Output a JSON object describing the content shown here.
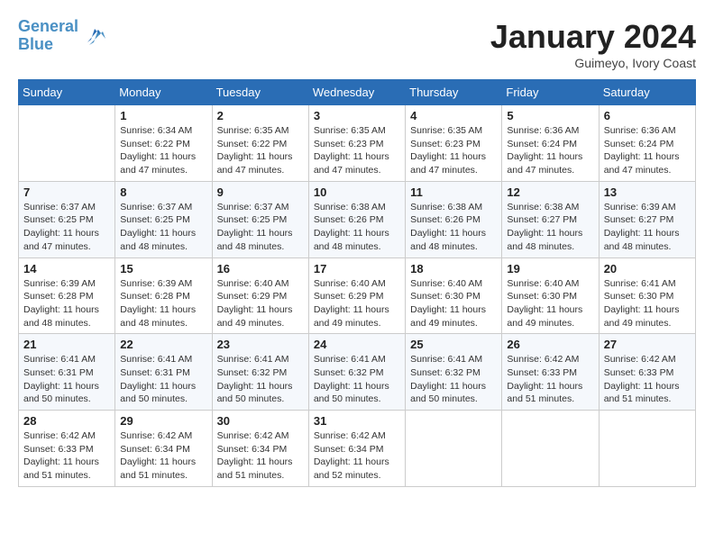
{
  "header": {
    "logo_line1": "General",
    "logo_line2": "Blue",
    "month": "January 2024",
    "location": "Guimeyo, Ivory Coast"
  },
  "days_of_week": [
    "Sunday",
    "Monday",
    "Tuesday",
    "Wednesday",
    "Thursday",
    "Friday",
    "Saturday"
  ],
  "weeks": [
    [
      {
        "day": "",
        "info": ""
      },
      {
        "day": "1",
        "info": "Sunrise: 6:34 AM\nSunset: 6:22 PM\nDaylight: 11 hours\nand 47 minutes."
      },
      {
        "day": "2",
        "info": "Sunrise: 6:35 AM\nSunset: 6:22 PM\nDaylight: 11 hours\nand 47 minutes."
      },
      {
        "day": "3",
        "info": "Sunrise: 6:35 AM\nSunset: 6:23 PM\nDaylight: 11 hours\nand 47 minutes."
      },
      {
        "day": "4",
        "info": "Sunrise: 6:35 AM\nSunset: 6:23 PM\nDaylight: 11 hours\nand 47 minutes."
      },
      {
        "day": "5",
        "info": "Sunrise: 6:36 AM\nSunset: 6:24 PM\nDaylight: 11 hours\nand 47 minutes."
      },
      {
        "day": "6",
        "info": "Sunrise: 6:36 AM\nSunset: 6:24 PM\nDaylight: 11 hours\nand 47 minutes."
      }
    ],
    [
      {
        "day": "7",
        "info": "Sunrise: 6:37 AM\nSunset: 6:25 PM\nDaylight: 11 hours\nand 47 minutes."
      },
      {
        "day": "8",
        "info": "Sunrise: 6:37 AM\nSunset: 6:25 PM\nDaylight: 11 hours\nand 48 minutes."
      },
      {
        "day": "9",
        "info": "Sunrise: 6:37 AM\nSunset: 6:25 PM\nDaylight: 11 hours\nand 48 minutes."
      },
      {
        "day": "10",
        "info": "Sunrise: 6:38 AM\nSunset: 6:26 PM\nDaylight: 11 hours\nand 48 minutes."
      },
      {
        "day": "11",
        "info": "Sunrise: 6:38 AM\nSunset: 6:26 PM\nDaylight: 11 hours\nand 48 minutes."
      },
      {
        "day": "12",
        "info": "Sunrise: 6:38 AM\nSunset: 6:27 PM\nDaylight: 11 hours\nand 48 minutes."
      },
      {
        "day": "13",
        "info": "Sunrise: 6:39 AM\nSunset: 6:27 PM\nDaylight: 11 hours\nand 48 minutes."
      }
    ],
    [
      {
        "day": "14",
        "info": "Sunrise: 6:39 AM\nSunset: 6:28 PM\nDaylight: 11 hours\nand 48 minutes."
      },
      {
        "day": "15",
        "info": "Sunrise: 6:39 AM\nSunset: 6:28 PM\nDaylight: 11 hours\nand 48 minutes."
      },
      {
        "day": "16",
        "info": "Sunrise: 6:40 AM\nSunset: 6:29 PM\nDaylight: 11 hours\nand 49 minutes."
      },
      {
        "day": "17",
        "info": "Sunrise: 6:40 AM\nSunset: 6:29 PM\nDaylight: 11 hours\nand 49 minutes."
      },
      {
        "day": "18",
        "info": "Sunrise: 6:40 AM\nSunset: 6:30 PM\nDaylight: 11 hours\nand 49 minutes."
      },
      {
        "day": "19",
        "info": "Sunrise: 6:40 AM\nSunset: 6:30 PM\nDaylight: 11 hours\nand 49 minutes."
      },
      {
        "day": "20",
        "info": "Sunrise: 6:41 AM\nSunset: 6:30 PM\nDaylight: 11 hours\nand 49 minutes."
      }
    ],
    [
      {
        "day": "21",
        "info": "Sunrise: 6:41 AM\nSunset: 6:31 PM\nDaylight: 11 hours\nand 50 minutes."
      },
      {
        "day": "22",
        "info": "Sunrise: 6:41 AM\nSunset: 6:31 PM\nDaylight: 11 hours\nand 50 minutes."
      },
      {
        "day": "23",
        "info": "Sunrise: 6:41 AM\nSunset: 6:32 PM\nDaylight: 11 hours\nand 50 minutes."
      },
      {
        "day": "24",
        "info": "Sunrise: 6:41 AM\nSunset: 6:32 PM\nDaylight: 11 hours\nand 50 minutes."
      },
      {
        "day": "25",
        "info": "Sunrise: 6:41 AM\nSunset: 6:32 PM\nDaylight: 11 hours\nand 50 minutes."
      },
      {
        "day": "26",
        "info": "Sunrise: 6:42 AM\nSunset: 6:33 PM\nDaylight: 11 hours\nand 51 minutes."
      },
      {
        "day": "27",
        "info": "Sunrise: 6:42 AM\nSunset: 6:33 PM\nDaylight: 11 hours\nand 51 minutes."
      }
    ],
    [
      {
        "day": "28",
        "info": "Sunrise: 6:42 AM\nSunset: 6:33 PM\nDaylight: 11 hours\nand 51 minutes."
      },
      {
        "day": "29",
        "info": "Sunrise: 6:42 AM\nSunset: 6:34 PM\nDaylight: 11 hours\nand 51 minutes."
      },
      {
        "day": "30",
        "info": "Sunrise: 6:42 AM\nSunset: 6:34 PM\nDaylight: 11 hours\nand 51 minutes."
      },
      {
        "day": "31",
        "info": "Sunrise: 6:42 AM\nSunset: 6:34 PM\nDaylight: 11 hours\nand 52 minutes."
      },
      {
        "day": "",
        "info": ""
      },
      {
        "day": "",
        "info": ""
      },
      {
        "day": "",
        "info": ""
      }
    ]
  ]
}
